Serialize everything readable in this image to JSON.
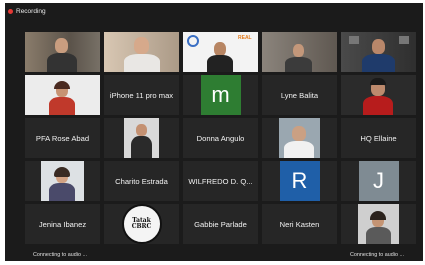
{
  "recording": {
    "label": "Recording"
  },
  "participants": [
    {
      "name": "",
      "type": "video"
    },
    {
      "name": "",
      "type": "video"
    },
    {
      "name": "",
      "type": "video",
      "overlay": "REAL"
    },
    {
      "name": "",
      "type": "video"
    },
    {
      "name": "",
      "type": "video"
    },
    {
      "name": "",
      "type": "video"
    },
    {
      "name": "iPhone 11 pro max",
      "type": "name"
    },
    {
      "name": "",
      "type": "avatar",
      "initial": "m",
      "color": "#2e7d32"
    },
    {
      "name": "Lyne Balita",
      "type": "name"
    },
    {
      "name": "",
      "type": "video"
    },
    {
      "name": "PFA Rose Abad",
      "type": "name"
    },
    {
      "name": "",
      "type": "video"
    },
    {
      "name": "Donna Angulo",
      "type": "name"
    },
    {
      "name": "",
      "type": "video"
    },
    {
      "name": "HQ Ellaine",
      "type": "name"
    },
    {
      "name": "",
      "type": "video"
    },
    {
      "name": "Charito Estrada",
      "type": "name"
    },
    {
      "name": "WILFREDO D. Q...",
      "type": "name"
    },
    {
      "name": "",
      "type": "avatar",
      "initial": "R",
      "color": "#1f5fa8"
    },
    {
      "name": "",
      "type": "avatar",
      "initial": "J",
      "color": "#7f8b93"
    },
    {
      "name": "Jenina Ibanez",
      "type": "name"
    },
    {
      "name": "",
      "type": "image",
      "logo_text": "Tatak CBRC"
    },
    {
      "name": "Gabbie Parlade",
      "type": "name"
    },
    {
      "name": "Neri Kasten",
      "type": "name"
    },
    {
      "name": "",
      "type": "video"
    }
  ],
  "statuses": {
    "left": "Connecting to audio ...",
    "right": "Connecting to audio ..."
  },
  "colors": {
    "background": "#1b1b1b",
    "tile": "#262626",
    "recording": "#e53935"
  }
}
